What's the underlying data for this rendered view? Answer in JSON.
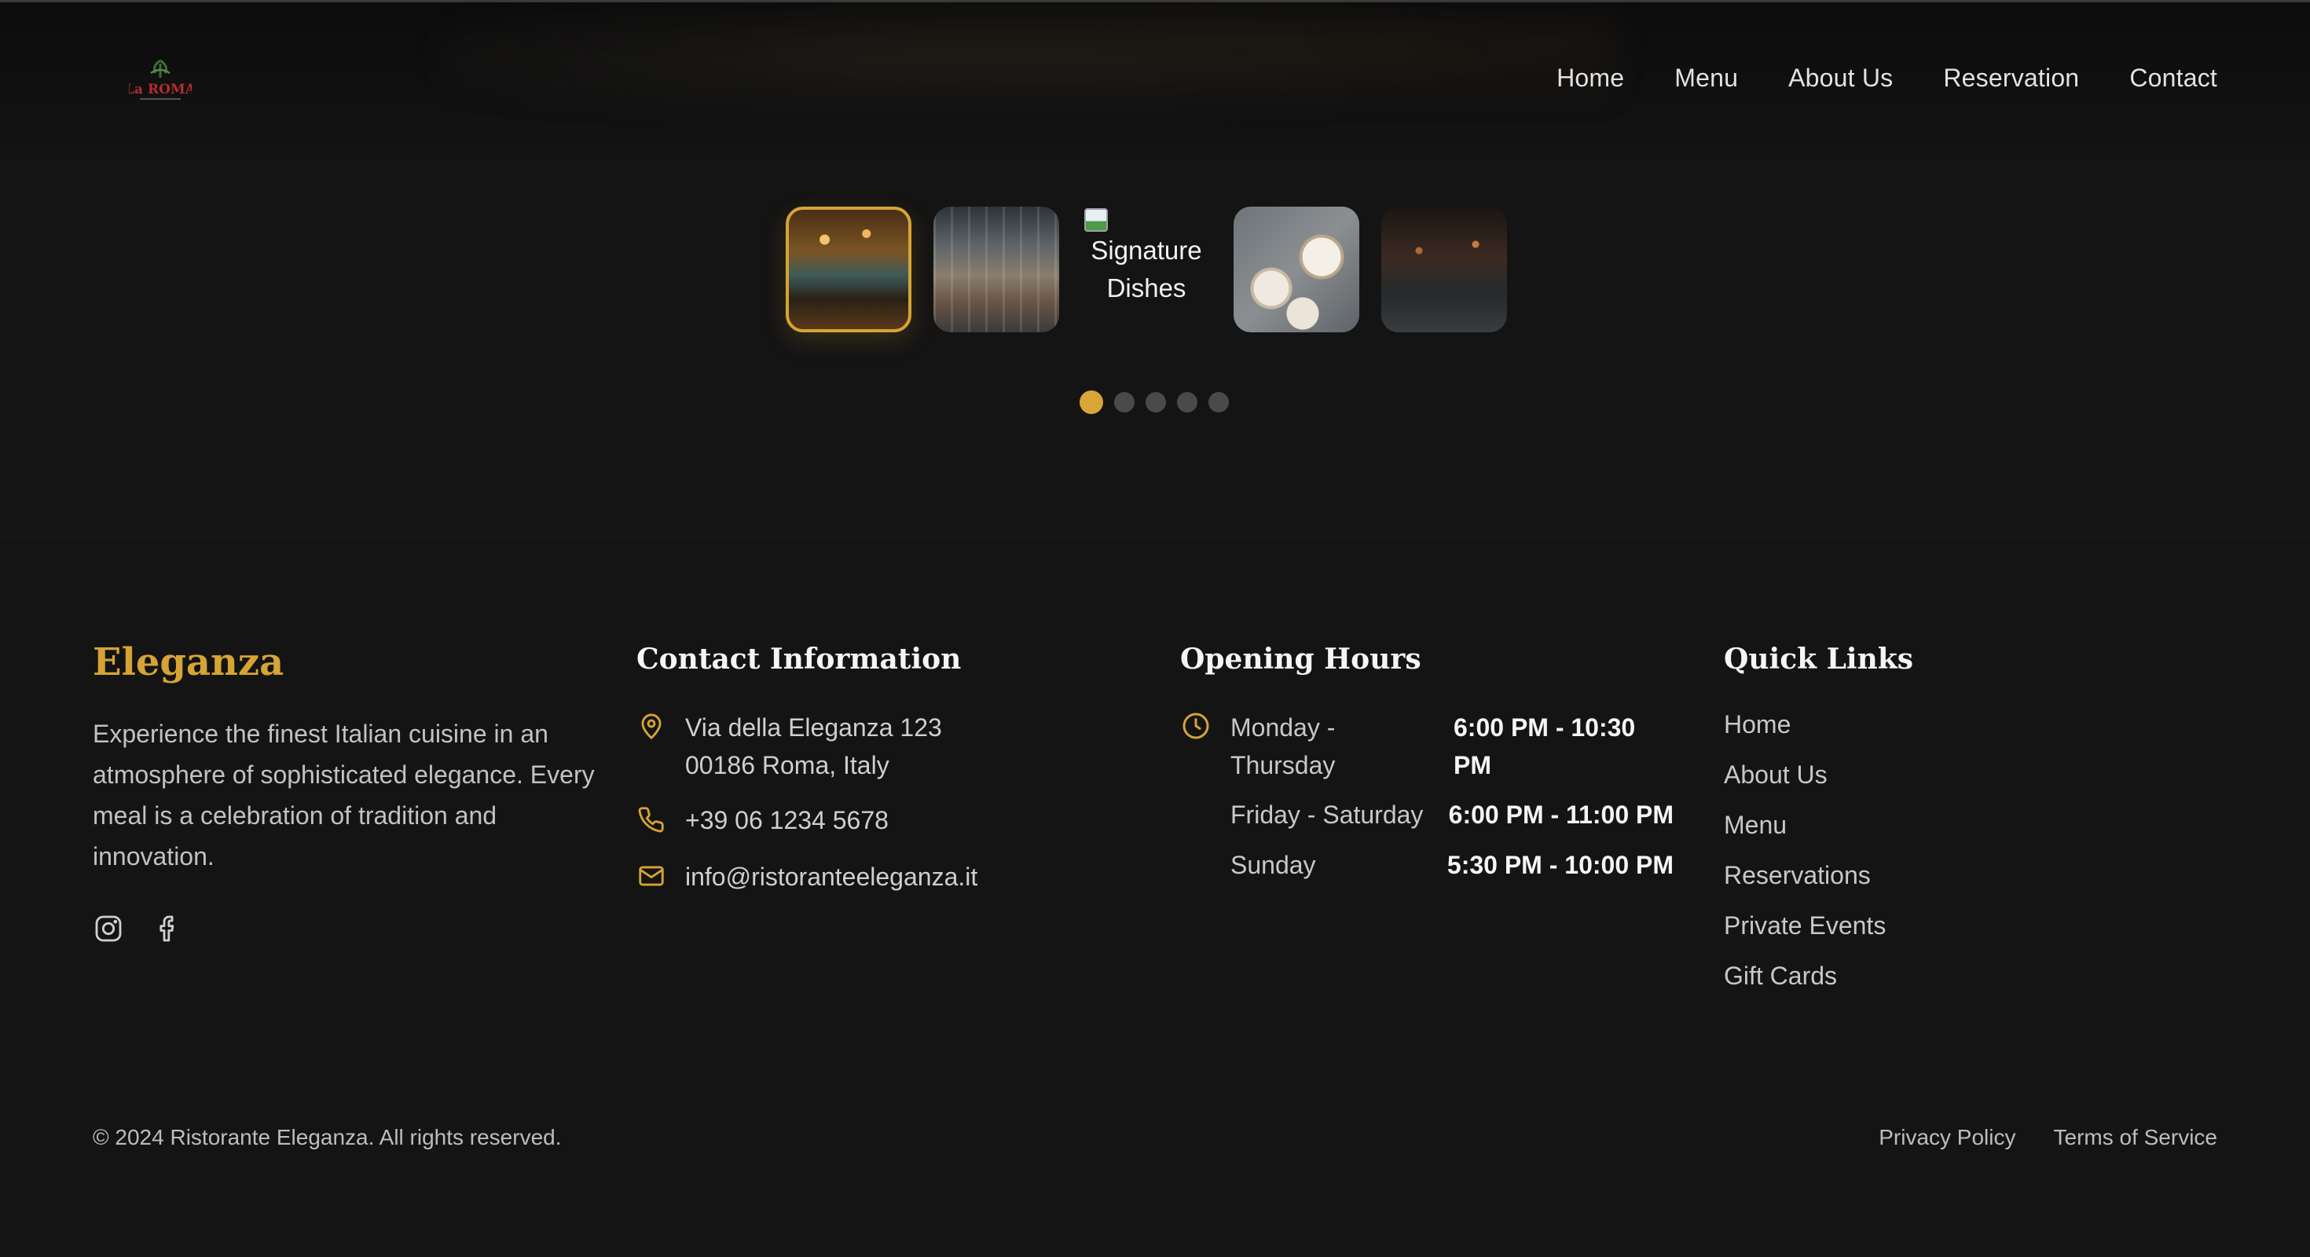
{
  "header": {
    "logo_icon": "la-roma-logo",
    "logo_text": "La ROMA",
    "nav": [
      "Home",
      "Menu",
      "About Us",
      "Reservation",
      "Contact"
    ]
  },
  "carousel": {
    "thumbnails": [
      {
        "name": "bar-interior-thumbnail",
        "active": true
      },
      {
        "name": "dining-hall-thumbnail",
        "active": false
      },
      {
        "name": "signature-dishes-thumbnail",
        "broken": true,
        "alt": "Signature Dishes"
      },
      {
        "name": "table-dishes-thumbnail",
        "active": false
      },
      {
        "name": "evening-dining-thumbnail",
        "active": false
      }
    ],
    "dots": 5,
    "active_index": 0
  },
  "footer": {
    "brand": "Eleganza",
    "description": "Experience the finest Italian cuisine in an atmosphere of sophisticated elegance. Every meal is a celebration of tradition and innovation.",
    "socials": [
      "instagram-icon",
      "facebook-icon"
    ],
    "contact": {
      "title": "Contact Information",
      "address_line1": "Via della Eleganza 123",
      "address_line2": "00186 Roma, Italy",
      "phone": "+39 06 1234 5678",
      "email": "info@ristoranteeleganza.it"
    },
    "hours": {
      "title": "Opening Hours",
      "rows": [
        {
          "day": "Monday - Thursday",
          "time": "6:00 PM - 10:30 PM"
        },
        {
          "day": "Friday - Saturday",
          "time": "6:00 PM - 11:00 PM"
        },
        {
          "day": "Sunday",
          "time": "5:30 PM - 10:00 PM"
        }
      ]
    },
    "quick_links": {
      "title": "Quick Links",
      "items": [
        "Home",
        "About Us",
        "Menu",
        "Reservations",
        "Private Events",
        "Gift Cards"
      ]
    },
    "copyright": "© 2024 Ristorante Eleganza. All rights reserved.",
    "legal": [
      "Privacy Policy",
      "Terms of Service"
    ]
  },
  "colors": {
    "accent": "#d6a435",
    "background": "#141414"
  }
}
